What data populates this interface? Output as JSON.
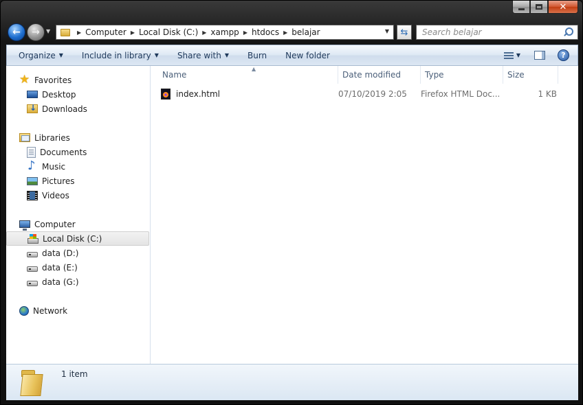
{
  "window": {
    "minimize_label": "",
    "close_label": "✕"
  },
  "address": {
    "crumbs": [
      "Computer",
      "Local Disk (C:)",
      "xampp",
      "htdocs",
      "belajar"
    ]
  },
  "search": {
    "placeholder": "Search belajar"
  },
  "toolbar": {
    "organize": "Organize",
    "include_in_library": "Include in library",
    "share_with": "Share with",
    "burn": "Burn",
    "new_folder": "New folder",
    "help": "?"
  },
  "nav_pane": {
    "favorites": "Favorites",
    "desktop": "Desktop",
    "downloads": "Downloads",
    "libraries": "Libraries",
    "documents": "Documents",
    "music": "Music",
    "pictures": "Pictures",
    "videos": "Videos",
    "computer": "Computer",
    "local_disk_c": "Local Disk (C:)",
    "data_d": "data (D:)",
    "data_e": "data (E:)",
    "data_g": "data (G:)",
    "network": "Network"
  },
  "columns": {
    "name": "Name",
    "date_modified": "Date modified",
    "type": "Type",
    "size": "Size"
  },
  "files": [
    {
      "name": "index.html",
      "date_modified": "07/10/2019 2:05",
      "type": "Firefox HTML Doc...",
      "size": "1 KB"
    }
  ],
  "details": {
    "item_count": "1 item"
  },
  "colors": {
    "accent": "#1e395b",
    "selection": "#e4e4e4"
  }
}
